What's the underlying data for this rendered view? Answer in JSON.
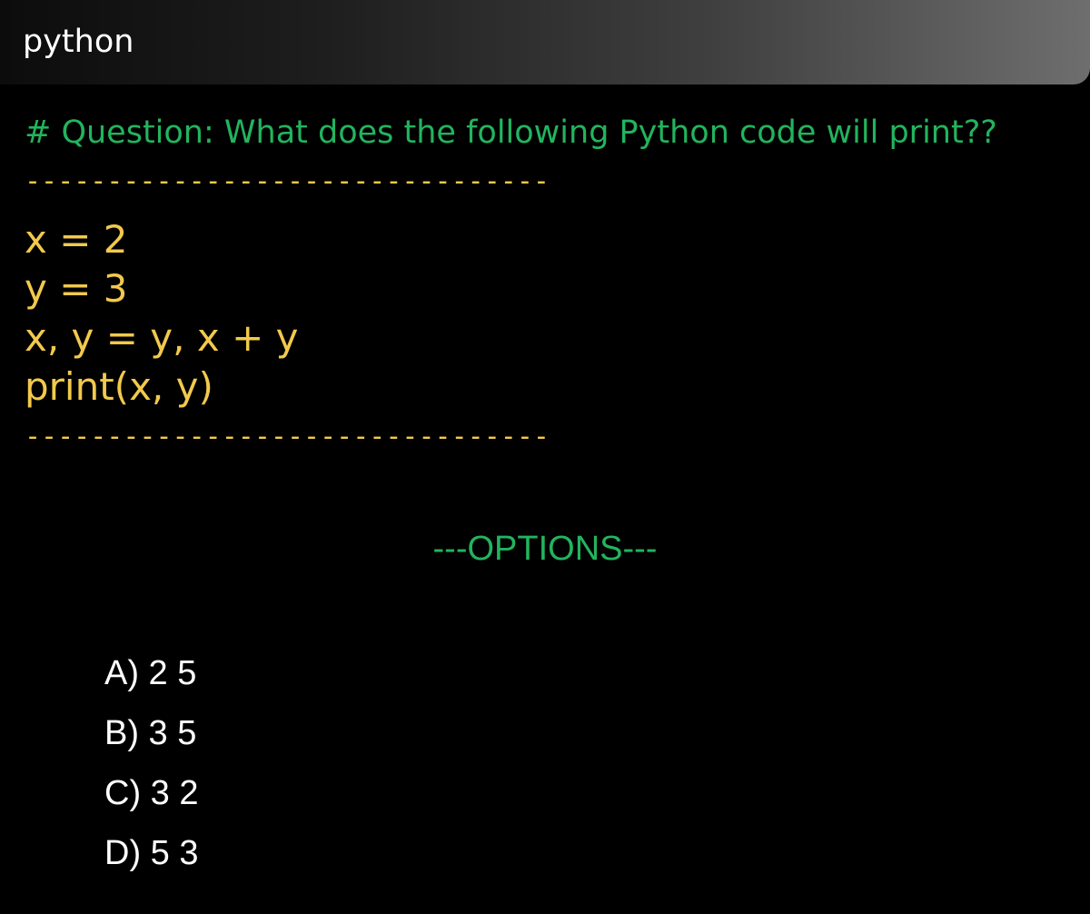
{
  "header": {
    "title": "python"
  },
  "question": "# Question: What does the following Python code will print??",
  "divider": "--------------------------------",
  "code": [
    "x = 2",
    "y = 3",
    "x, y = y, x + y",
    "print(x, y)"
  ],
  "options_header": "---OPTIONS---",
  "options": [
    "A) 2 5",
    "B) 3 5",
    "C) 3 2",
    "D) 5 3"
  ],
  "colors": {
    "background": "#000000",
    "question_green": "#22b45e",
    "code_yellow": "#f2c94c",
    "option_white": "#ffffff"
  }
}
